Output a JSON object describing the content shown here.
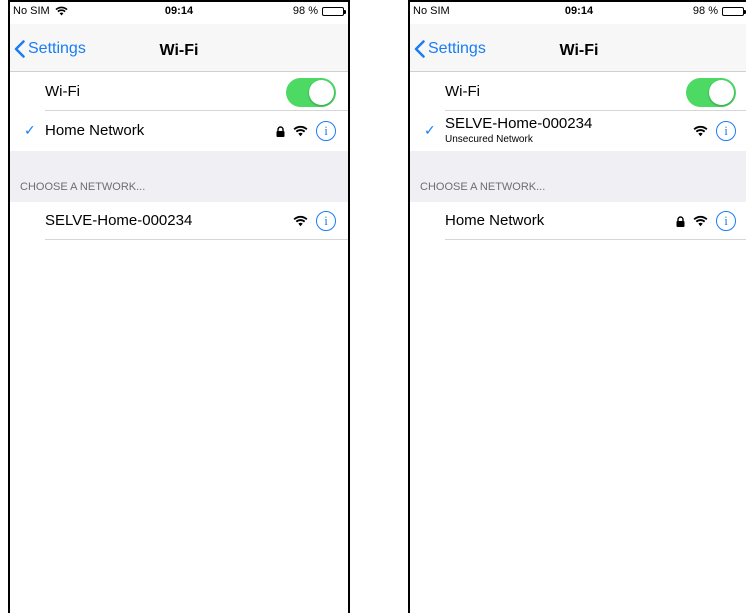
{
  "left": {
    "status": {
      "carrier": "No SIM",
      "time": "09:14",
      "battery": "98 %"
    },
    "nav": {
      "back_label": "Settings",
      "title": "Wi-Fi"
    },
    "wifi_row": {
      "label": "Wi-Fi",
      "toggle": "on"
    },
    "connected": {
      "name": "Home Network",
      "secured": true
    },
    "section_header": "CHOOSE A NETWORK...",
    "networks": [
      {
        "name": "SELVE-Home-000234",
        "secured": false
      }
    ]
  },
  "right": {
    "status": {
      "carrier": "No SIM",
      "time": "09:14",
      "battery": "98 %"
    },
    "nav": {
      "back_label": "Settings",
      "title": "Wi-Fi"
    },
    "wifi_row": {
      "label": "Wi-Fi",
      "toggle": "on"
    },
    "connected": {
      "name": "SELVE-Home-000234",
      "subtitle": "Unsecured Network",
      "secured": false
    },
    "section_header": "CHOOSE A NETWORK...",
    "networks": [
      {
        "name": "Home Network",
        "secured": true
      }
    ]
  },
  "icons": {
    "info_glyph": "i"
  },
  "colors": {
    "accent": "#1a7cf5",
    "toggle_on": "#4cd964",
    "group_bg": "#efeff4"
  }
}
